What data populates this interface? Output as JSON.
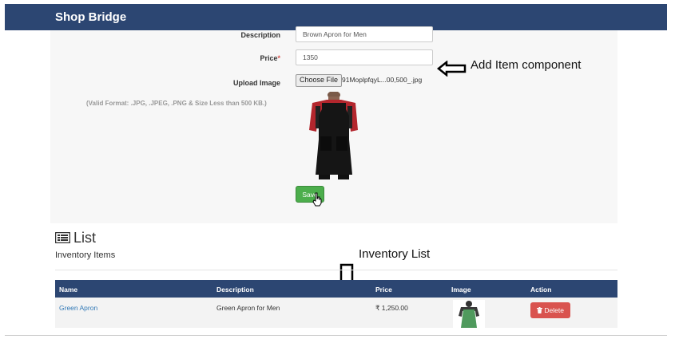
{
  "navbar": {
    "brand": "Shop Bridge"
  },
  "form": {
    "description_label": "Description",
    "description_value": "Brown Apron for Men",
    "price_label": "Price",
    "price_required": "*",
    "price_value": "1350",
    "upload_label": "Upload Image",
    "choose_file_label": "Choose File",
    "file_name": "91MoplpfqyL...00,500_.jpg",
    "format_hint": "(Valid Format: .JPG, .JPEG, .PNG & Size Less than 500 KB.)",
    "save_label": "Save"
  },
  "annotations": {
    "add_item": "Add Item component",
    "inventory_list": "Inventory List"
  },
  "list": {
    "title": "List",
    "subtitle": "Inventory Items",
    "columns": [
      "Name",
      "Description",
      "Price",
      "Image",
      "Action"
    ],
    "rows": [
      {
        "name": "Green Apron",
        "description": "Green Apron for Men",
        "price": "₹ 1,250.00",
        "delete_label": "Delete"
      }
    ]
  },
  "colors": {
    "navbar": "#2c4672",
    "save": "#4cae4c",
    "delete": "#d9534f",
    "link": "#337ab7"
  },
  "icons": [
    "list-icon",
    "trash-icon",
    "hand-cursor-icon",
    "left-arrow-icon",
    "down-arrow-icon"
  ]
}
